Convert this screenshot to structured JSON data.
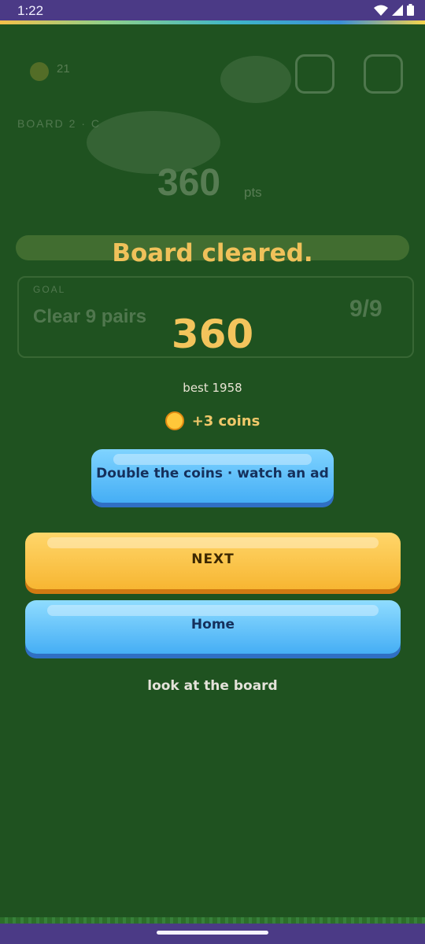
{
  "status_bar": {
    "time": "1:22"
  },
  "background": {
    "coins": "21",
    "board_label": "BOARD 2 · C",
    "score": "360",
    "score_unit": "pts",
    "goal_tag": "GOAL",
    "goal_text": "Clear 9 pairs",
    "goal_progress": "9/9"
  },
  "result": {
    "title": "Board cleared.",
    "score": "360",
    "best": "best 1958",
    "reward": "+3 coins"
  },
  "buttons": {
    "double_coins": "Double the coins · watch an ad",
    "next": "NEXT",
    "home": "Home",
    "look": "look at the board"
  },
  "icons": [
    "wifi-icon",
    "signal-icon",
    "battery-icon",
    "coin-icon",
    "restart-icon",
    "home-icon"
  ],
  "colors": {
    "overlay_bg": "#1f5220",
    "title": "#f0c15a",
    "next_button": "#f7b632",
    "blue_button": "#45aef5",
    "status_bar": "#4b3a86"
  }
}
